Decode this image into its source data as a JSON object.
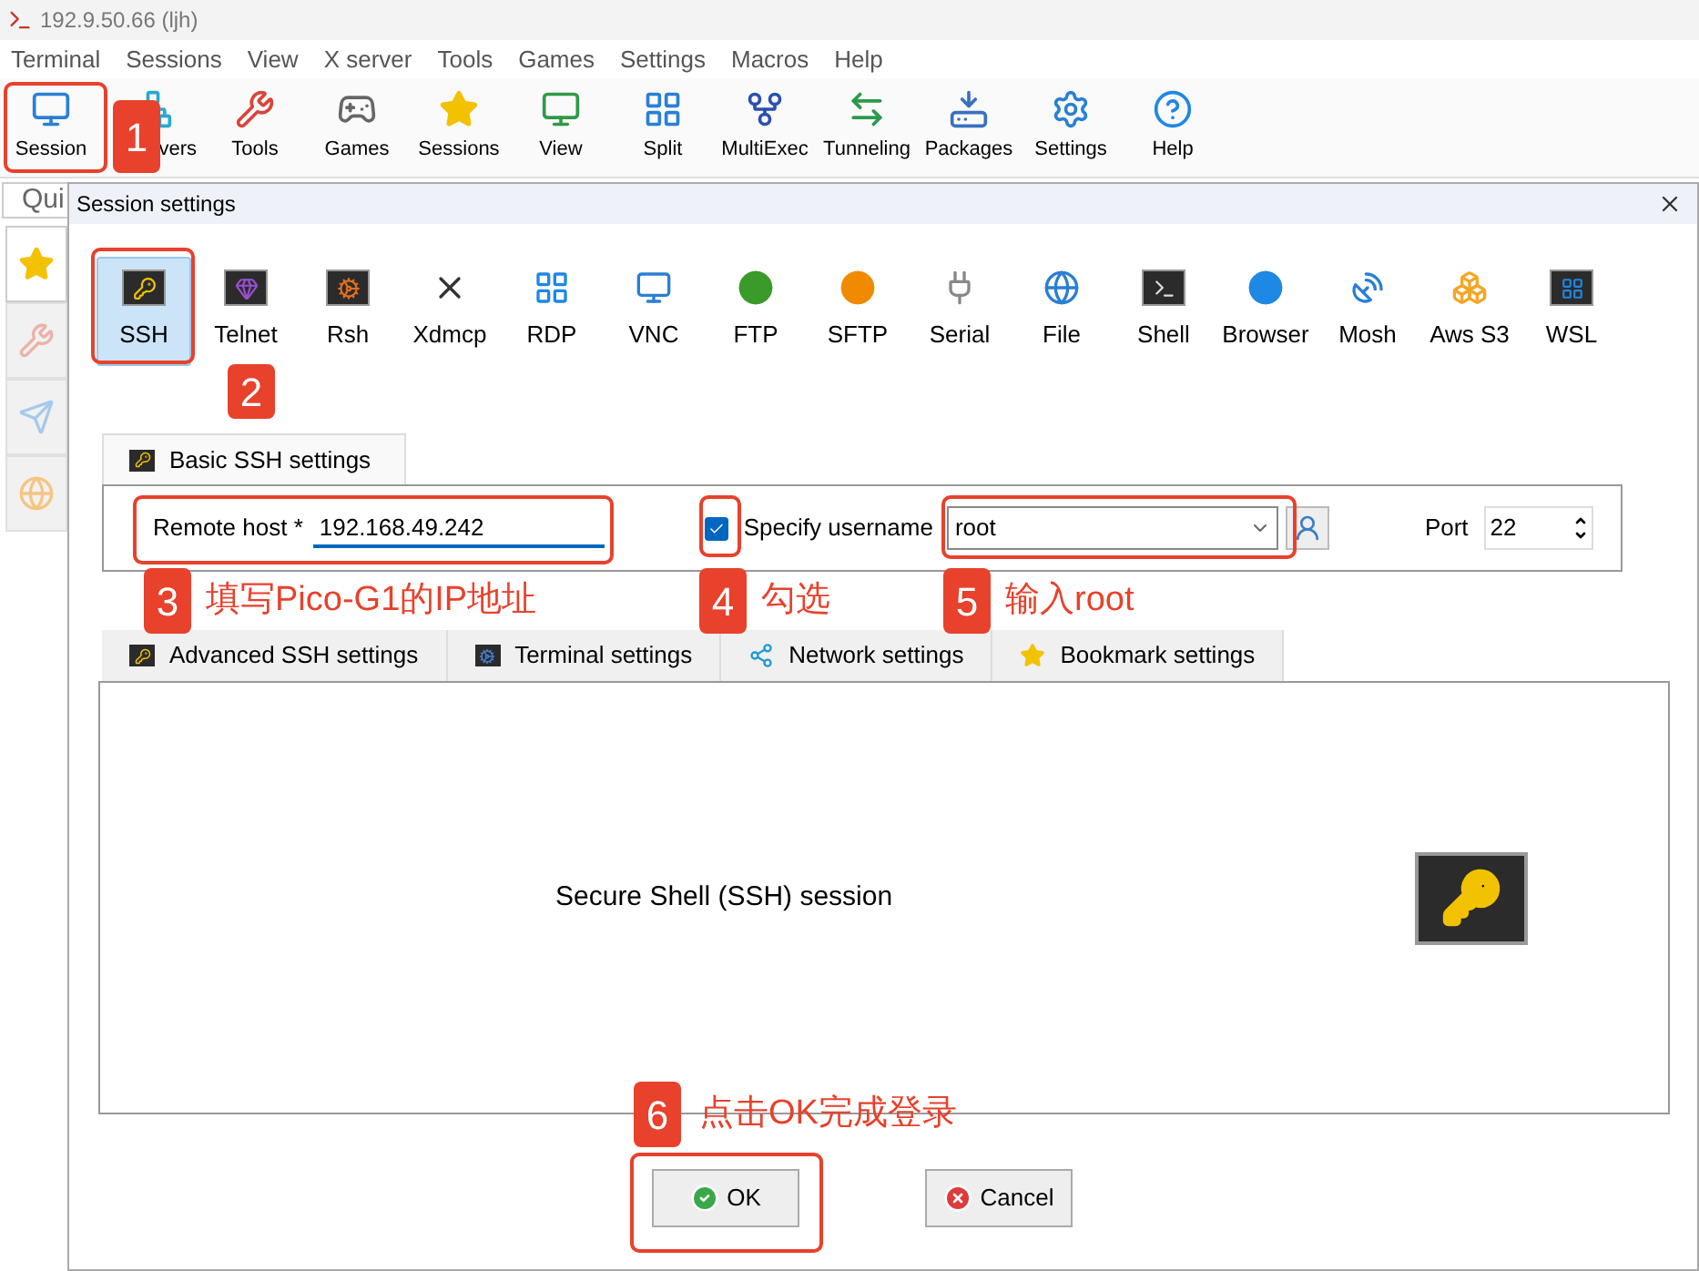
{
  "window": {
    "title": "192.9.50.66 (ljh)"
  },
  "menu": [
    "Terminal",
    "Sessions",
    "View",
    "X server",
    "Tools",
    "Games",
    "Settings",
    "Macros",
    "Help"
  ],
  "toolbar": [
    {
      "label": "Session"
    },
    {
      "label": "vers"
    },
    {
      "label": "Tools"
    },
    {
      "label": "Games"
    },
    {
      "label": "Sessions"
    },
    {
      "label": "View"
    },
    {
      "label": "Split"
    },
    {
      "label": "MultiExec"
    },
    {
      "label": "Tunneling"
    },
    {
      "label": "Packages"
    },
    {
      "label": "Settings"
    },
    {
      "label": "Help"
    }
  ],
  "quick_connect": {
    "placeholder": "Qui"
  },
  "sidebar_tabs": [
    {
      "selected": true
    },
    {
      "selected": false
    },
    {
      "selected": false
    },
    {
      "selected": false
    }
  ],
  "dialog": {
    "title": "Session settings",
    "session_types": [
      {
        "label": "SSH",
        "selected": true
      },
      {
        "label": "Telnet",
        "selected": false
      },
      {
        "label": "Rsh",
        "selected": false
      },
      {
        "label": "Xdmcp",
        "selected": false
      },
      {
        "label": "RDP",
        "selected": false
      },
      {
        "label": "VNC",
        "selected": false
      },
      {
        "label": "FTP",
        "selected": false
      },
      {
        "label": "SFTP",
        "selected": false
      },
      {
        "label": "Serial",
        "selected": false
      },
      {
        "label": "File",
        "selected": false
      },
      {
        "label": "Shell",
        "selected": false
      },
      {
        "label": "Browser",
        "selected": false
      },
      {
        "label": "Mosh",
        "selected": false
      },
      {
        "label": "Aws S3",
        "selected": false
      },
      {
        "label": "WSL",
        "selected": false
      }
    ],
    "basic_tab": {
      "label": "Basic SSH settings"
    },
    "remote_host": {
      "label": "Remote host *",
      "value": "192.168.49.242"
    },
    "specify_username": {
      "label": "Specify username",
      "checked": true
    },
    "username": {
      "value": "root"
    },
    "port": {
      "label": "Port",
      "value": "22"
    },
    "tabs": [
      {
        "label": "Advanced SSH settings",
        "selected": false
      },
      {
        "label": "Terminal settings",
        "selected": false
      },
      {
        "label": "Network settings",
        "selected": false
      },
      {
        "label": "Bookmark settings",
        "selected": false
      }
    ],
    "description": "Secure Shell (SSH) session",
    "buttons": [
      {
        "label": "OK",
        "kind": "ok"
      },
      {
        "label": "Cancel",
        "kind": "cancel"
      }
    ]
  },
  "annotations": [
    {
      "number": "1"
    },
    {
      "number": "2"
    },
    {
      "number": "3",
      "caption": "填写Pico-G1的IP地址"
    },
    {
      "number": "4",
      "caption": "勾选"
    },
    {
      "number": "5",
      "caption": "输入root"
    },
    {
      "number": "6",
      "caption": "点击OK完成登录"
    }
  ]
}
